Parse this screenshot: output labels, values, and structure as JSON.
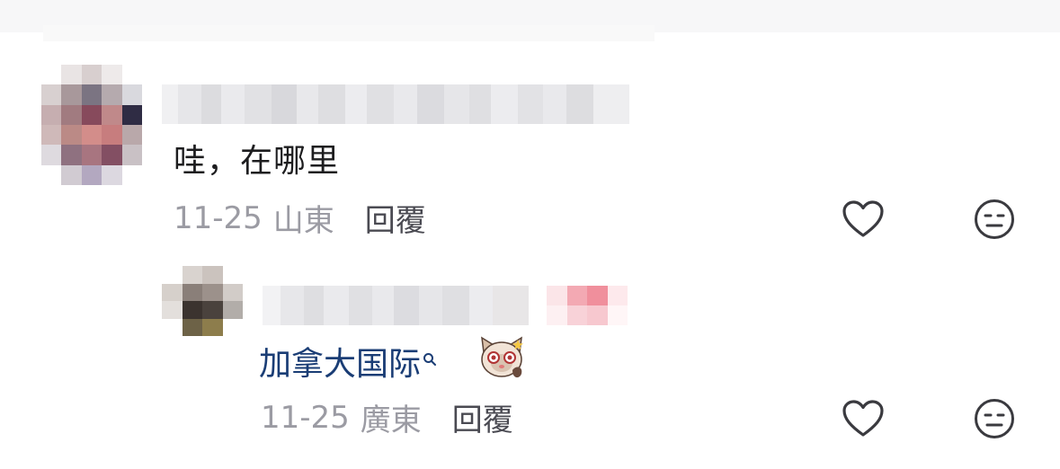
{
  "comments": [
    {
      "text": "哇，在哪里",
      "date": "11-25",
      "location": "山東",
      "reply_label": "回覆",
      "like_icon": "heart-outline-icon",
      "dislike_icon": "meh-face-icon"
    }
  ],
  "replies": [
    {
      "text": "加拿大国际",
      "search_icon": "search-icon",
      "emoji": "cat-face-emoji",
      "date": "11-25",
      "location": "廣東",
      "reply_label": "回覆",
      "like_icon": "heart-outline-icon",
      "dislike_icon": "meh-face-icon"
    }
  ],
  "colors": {
    "text_primary": "#1d1d1f",
    "text_meta": "#9b9ba3",
    "reply_button": "#4a4a52",
    "link_blue": "#1a3d75",
    "icon_stroke": "#3a3a3f"
  }
}
